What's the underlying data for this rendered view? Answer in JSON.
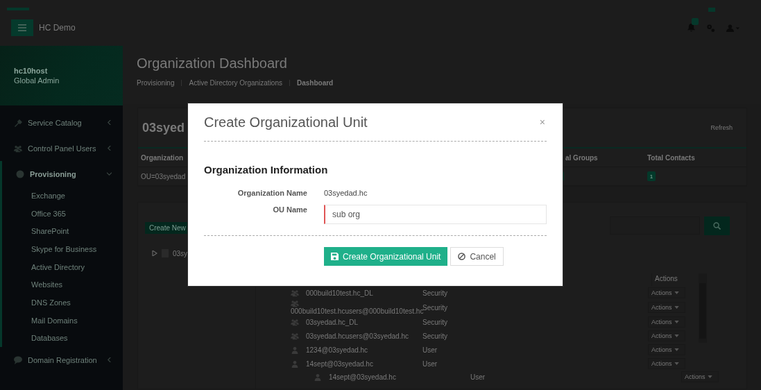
{
  "top_bar": {
    "app_name": "HC Demo"
  },
  "sidebar": {
    "user_name": "hc10host",
    "user_role": "Global Admin",
    "items": [
      {
        "label": "Service Catalog",
        "expanded": false
      },
      {
        "label": "Control Panel Users",
        "expanded": false
      },
      {
        "label": "Provisioning",
        "expanded": true,
        "children": [
          {
            "label": "Exchange"
          },
          {
            "label": "Office 365"
          },
          {
            "label": "SharePoint"
          },
          {
            "label": "Skype for Business"
          },
          {
            "label": "Active Directory"
          },
          {
            "label": "Websites"
          },
          {
            "label": "DNS Zones"
          },
          {
            "label": "Mail Domains"
          },
          {
            "label": "Databases"
          }
        ]
      },
      {
        "label": "Domain Registration",
        "expanded": false
      }
    ]
  },
  "header": {
    "title": "Organization Dashboard",
    "breadcrumb": [
      {
        "label": "Provisioning",
        "current": false
      },
      {
        "label": "Active Directory Organizations",
        "current": false
      },
      {
        "label": "Dashboard",
        "current": true
      }
    ]
  },
  "org_card": {
    "title": "03syed",
    "refresh": "Refresh",
    "columns": [
      "Organization",
      "al Groups",
      "Total Contacts"
    ],
    "row": {
      "organization": "OU=03syedad",
      "total_contacts": "1"
    }
  },
  "tree_panel": {
    "create_button": "Create New",
    "items": [
      {
        "label": "03sy",
        "expanded": false
      }
    ]
  },
  "members": {
    "actions_header": "Actions",
    "rows": [
      {
        "kind": "group",
        "name": "000build10test.hc_DL",
        "type": "Security",
        "action": "Actions"
      },
      {
        "kind": "group",
        "name": "000build10test.hcusers@000build10test.hc",
        "type": "Security",
        "action": "Actions"
      },
      {
        "kind": "group",
        "name": "03syedad.hc_DL",
        "type": "Security",
        "action": "Actions"
      },
      {
        "kind": "group",
        "name": "03syedad.hcusers@03syedad.hc",
        "type": "Security",
        "action": "Actions"
      },
      {
        "kind": "user",
        "name": "1234@03syedad.hc",
        "type": "User",
        "action": "Actions"
      },
      {
        "kind": "user",
        "name": "14sept@03syedad.hc",
        "type": "User",
        "action": "Actions"
      }
    ],
    "sub_row": {
      "kind": "user",
      "name": "14sept@03syedad.hc",
      "type": "User",
      "action": "Actions"
    }
  },
  "modal": {
    "title": "Create Organizational Unit",
    "close": "×",
    "section": "Organization Information",
    "fields": [
      {
        "kind": "static",
        "label": "Organization Name",
        "value": "03syedad.hc"
      },
      {
        "kind": "input",
        "label": "OU Name",
        "value": "sub org"
      }
    ],
    "buttons": [
      {
        "kind": "primary",
        "label": "Create Organizational Unit"
      },
      {
        "kind": "secondary",
        "label": "Cancel"
      }
    ]
  }
}
